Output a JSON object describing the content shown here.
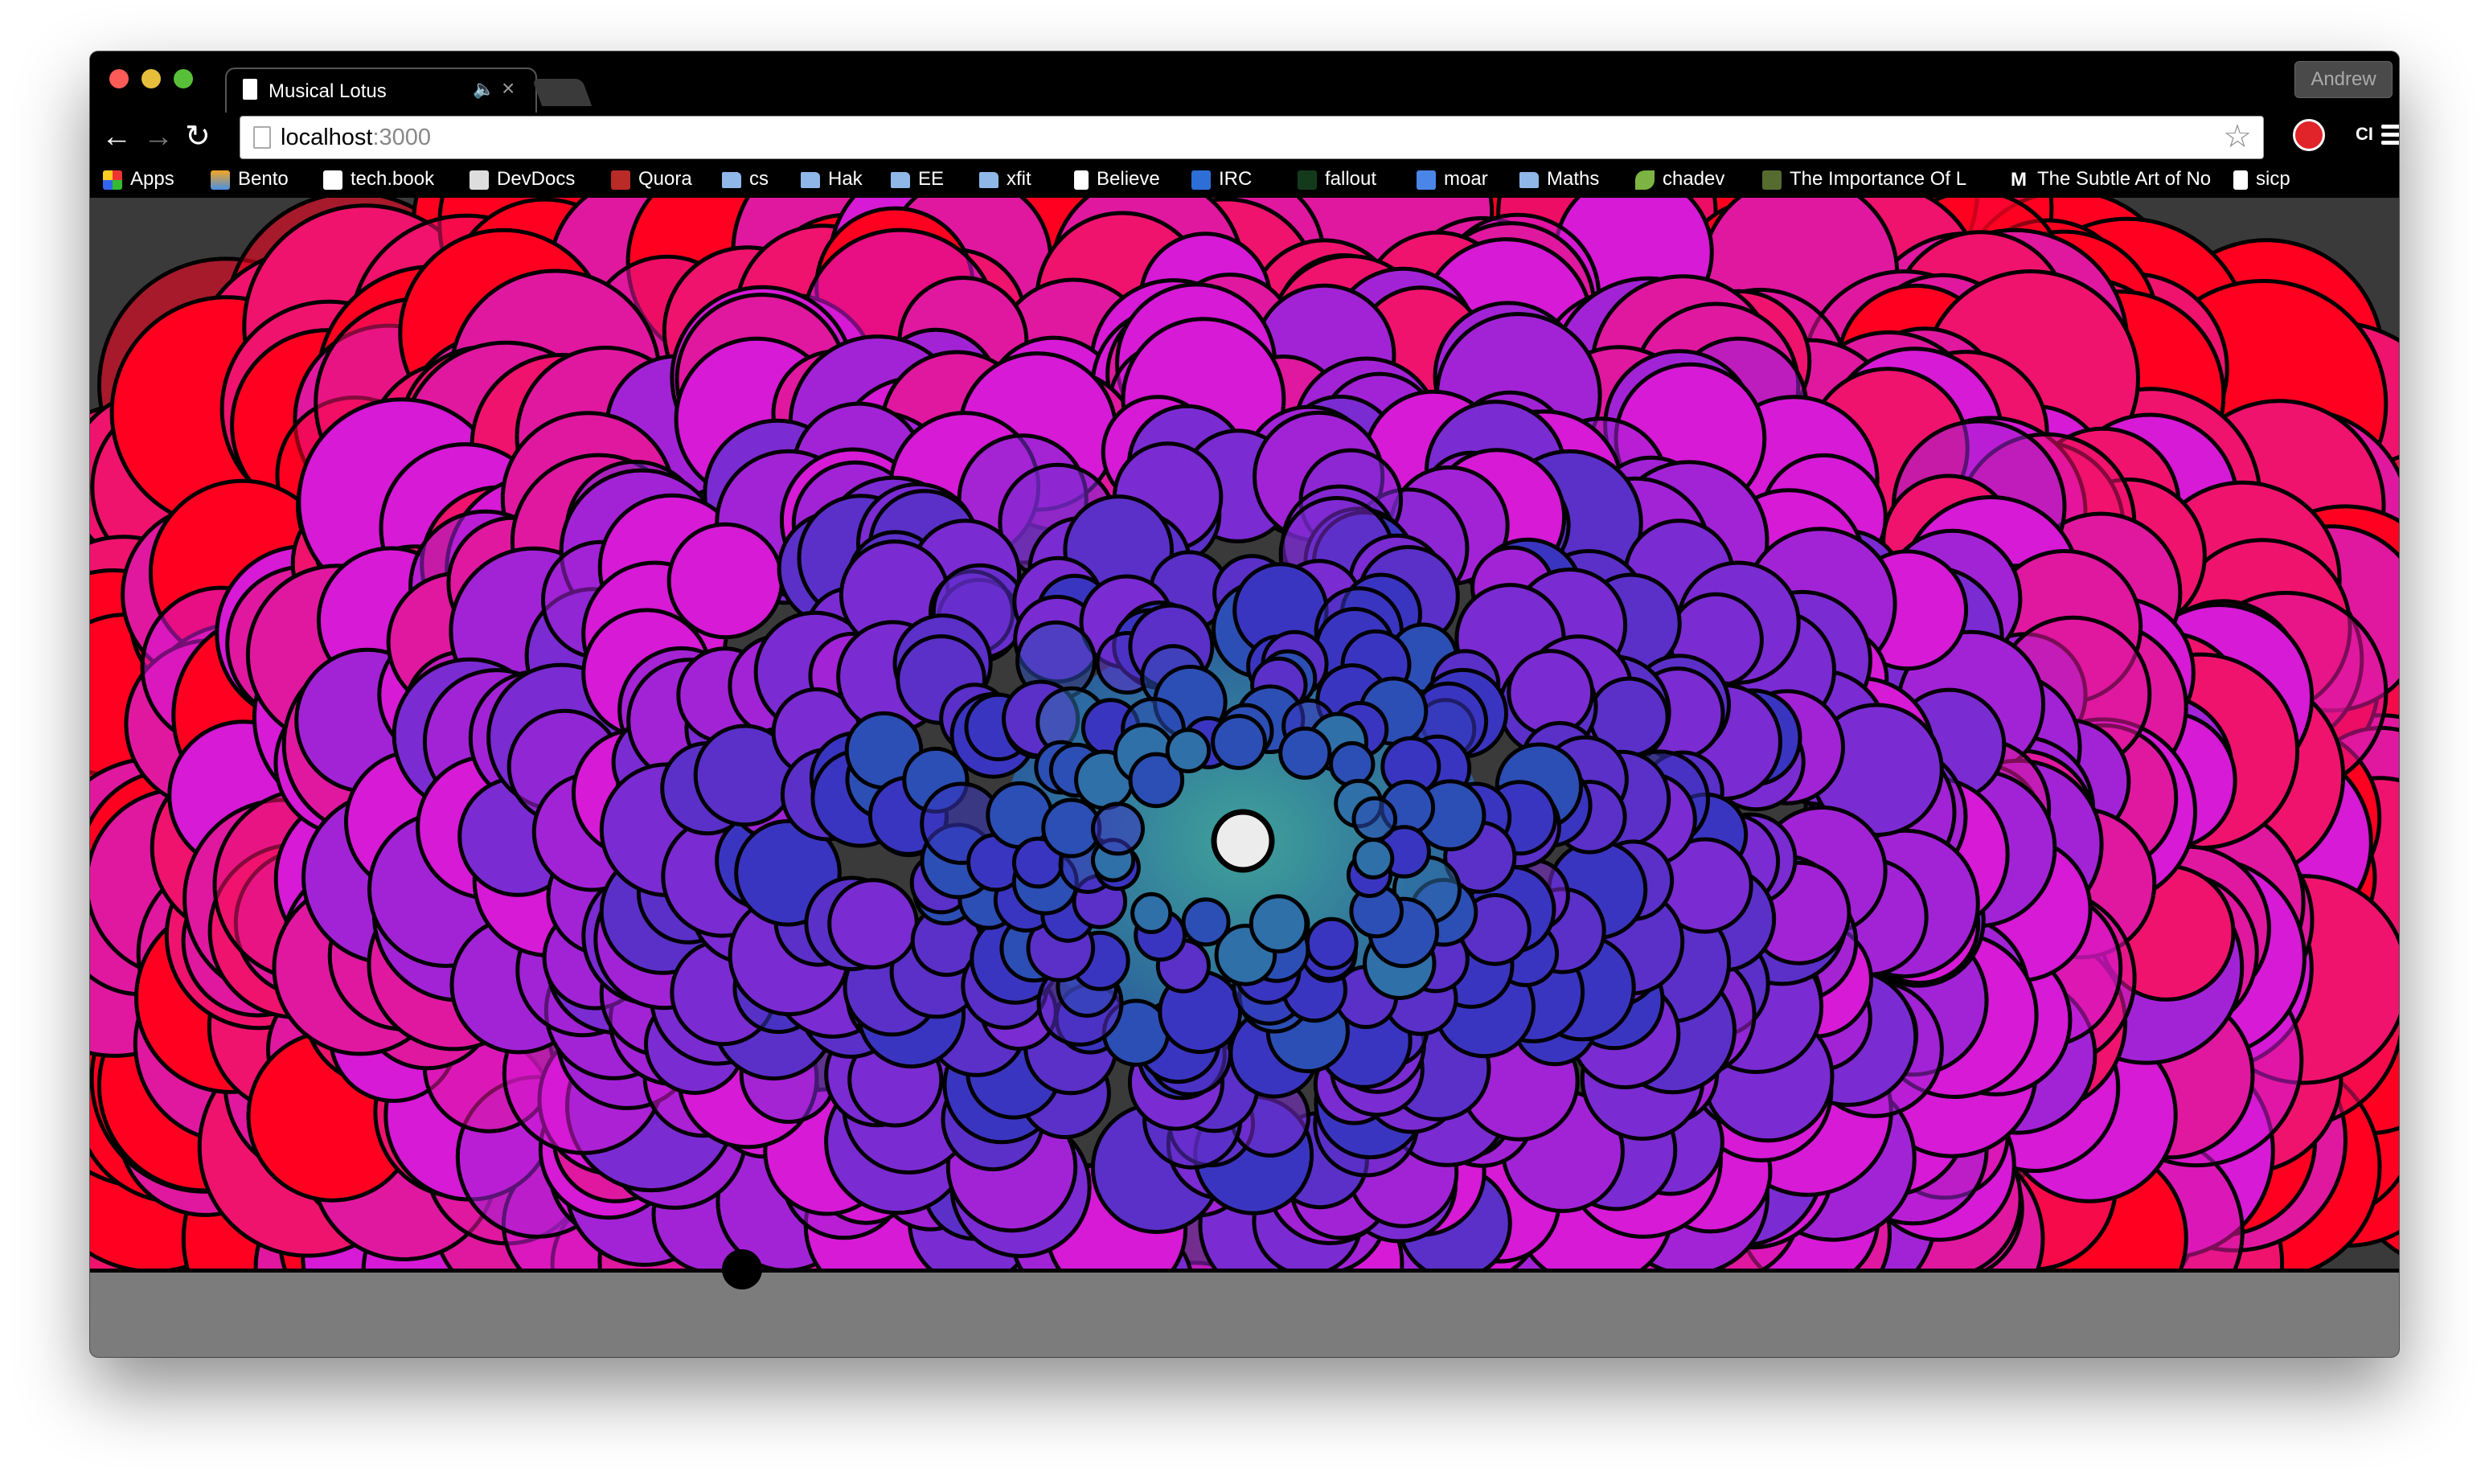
{
  "window": {
    "profile_name": "Andrew"
  },
  "tab": {
    "title": "Musical Lotus",
    "icon": "document-icon",
    "audio_icon": "speaker-icon",
    "close_glyph": "×"
  },
  "toolbar": {
    "url_host": "localhost",
    "url_port": ":3000",
    "back_glyph": "←",
    "forward_glyph": "→",
    "reload_glyph": "↻",
    "star_glyph": "☆",
    "extension_label": "CI"
  },
  "bookmarks": [
    {
      "label": "Apps",
      "icon": "apps-grid-icon"
    },
    {
      "label": "Bento",
      "icon": "bento-icon"
    },
    {
      "label": "tech.book",
      "icon": "amazon-icon"
    },
    {
      "label": "DevDocs",
      "icon": "devdocs-icon"
    },
    {
      "label": "Quora",
      "icon": "quora-icon"
    },
    {
      "label": "cs",
      "icon": "folder-icon"
    },
    {
      "label": "Hak",
      "icon": "folder-icon"
    },
    {
      "label": "EE",
      "icon": "folder-icon"
    },
    {
      "label": "xfit",
      "icon": "folder-icon"
    },
    {
      "label": "Believe",
      "icon": "document-icon"
    },
    {
      "label": "IRC",
      "icon": "irc-icon"
    },
    {
      "label": "fallout",
      "icon": "fallout-icon"
    },
    {
      "label": "moar",
      "icon": "docs-icon"
    },
    {
      "label": "Maths",
      "icon": "folder-icon"
    },
    {
      "label": "chadev",
      "icon": "leaf-icon"
    },
    {
      "label": "The Importance Of L",
      "icon": "t-icon"
    },
    {
      "label": "The Subtle Art of No",
      "icon": "medium-icon"
    },
    {
      "label": "sicp",
      "icon": "document-icon"
    }
  ],
  "visualization": {
    "palette": [
      "#ff0020",
      "#f0136e",
      "#e0189f",
      "#d61ad6",
      "#a223d6",
      "#7b2bd2",
      "#5a30c8",
      "#3a35c0",
      "#2c4fb5",
      "#2f70a8"
    ],
    "center_color": "#3fa29a",
    "core_color": "#ececec",
    "stroke_color": "#000000",
    "bar_color": "#7c7c7c"
  }
}
